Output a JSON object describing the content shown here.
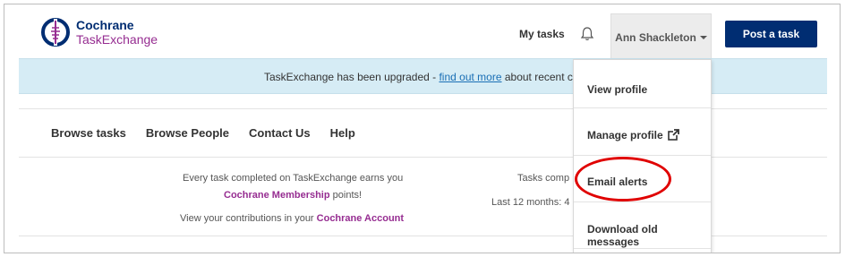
{
  "logo": {
    "line1": "Cochrane",
    "line2": "TaskExchange"
  },
  "header": {
    "my_tasks": "My tasks",
    "user_name": "Ann Shackleton",
    "post_button": "Post a task"
  },
  "banner": {
    "prefix": "TaskExchange has been upgraded - ",
    "link": "find out more",
    "suffix": " about recent chang"
  },
  "main_nav": [
    "Browse tasks",
    "Browse People",
    "Contact Us",
    "Help"
  ],
  "info": {
    "line1": "Every task completed on TaskExchange earns you",
    "membership": "Cochrane Membership",
    "points": " points!",
    "line3_prefix": "View your contributions in your ",
    "account_link": "Cochrane Account"
  },
  "stats": {
    "line1": "Tasks comp",
    "line2": "Last 12 months:  4"
  },
  "dropdown": {
    "items": [
      "View profile",
      "Manage profile",
      "Email alerts",
      "Download old messages"
    ]
  },
  "colors": {
    "navy": "#002d72",
    "purple": "#962d91",
    "banner": "#d6ecf5",
    "highlight": "#e00000"
  }
}
